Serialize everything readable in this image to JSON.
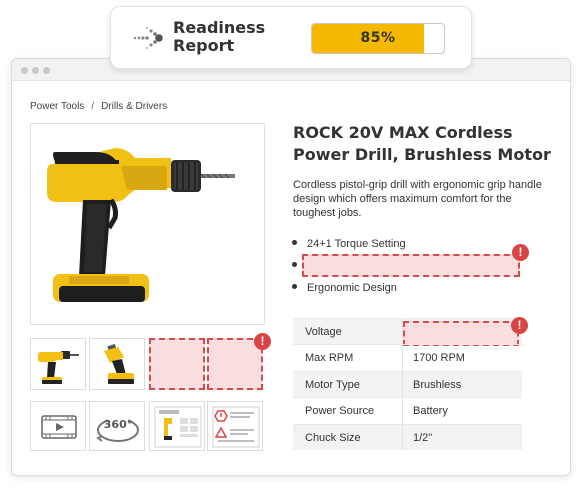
{
  "readiness": {
    "title": "Readiness Report",
    "percent_text": "85%",
    "percent_value": 85,
    "fill_color": "#f5b800"
  },
  "breadcrumb": {
    "items": [
      "Power Tools",
      "Drills & Drivers"
    ],
    "separator": "/"
  },
  "product": {
    "title": "ROCK 20V MAX Cordless Power Drill, Brushless Motor",
    "description": "Cordless pistol-grip drill with ergonomic grip handle design which offers maximum comfort for the toughest jobs.",
    "bullets": [
      "24+1 Torque Setting",
      "",
      "Ergonomic Design"
    ]
  },
  "specs": [
    {
      "label": "Voltage",
      "value": ""
    },
    {
      "label": "Max RPM",
      "value": "1700 RPM"
    },
    {
      "label": "Motor Type",
      "value": "Brushless"
    },
    {
      "label": "Power Source",
      "value": "Battery"
    },
    {
      "label": "Chuck Size",
      "value": "1/2\""
    }
  ],
  "media_icons": [
    "video-icon",
    "rotate-360-icon",
    "spec-sheet-icon",
    "safety-warning-icon"
  ],
  "rotate_label": "360°",
  "alert_glyph": "!",
  "colors": {
    "accent": "#f5b800",
    "missing_border": "#d94a4a",
    "missing_fill": "#f8dede",
    "alert": "#d94545"
  }
}
